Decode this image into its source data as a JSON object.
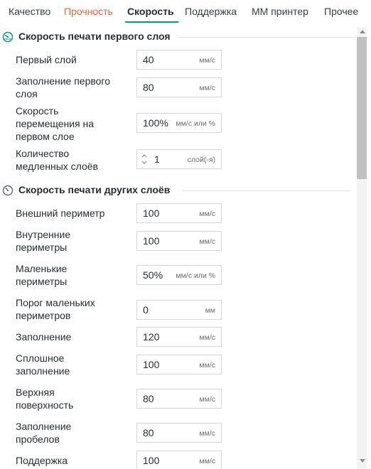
{
  "tabs": [
    {
      "label": "Качество"
    },
    {
      "label": "Прочность"
    },
    {
      "label": "Скорость"
    },
    {
      "label": "Поддержка"
    },
    {
      "label": "ММ принтер"
    },
    {
      "label": "Прочее"
    }
  ],
  "sections": [
    {
      "title": "Скорость печати первого слоя",
      "icon": "speedometer-icon",
      "rows": [
        {
          "label": "Первый слой",
          "value": "40",
          "unit": "мм/с"
        },
        {
          "label": "Заполнение первого слоя",
          "value": "80",
          "unit": "мм/с"
        },
        {
          "label": "Скорость перемещения на первом слое",
          "value": "100%",
          "unit": "мм/с или %"
        },
        {
          "label": "Количество медленных слоёв",
          "value": "1",
          "unit": "слой(-я)"
        }
      ]
    },
    {
      "title": "Скорость печати других слоёв",
      "icon": "speedometer-icon",
      "rows": [
        {
          "label": "Внешний периметр",
          "value": "100",
          "unit": "мм/с"
        },
        {
          "label": "Внутренние периметры",
          "value": "100",
          "unit": "мм/с"
        },
        {
          "label": "Маленькие периметры",
          "value": "50%",
          "unit": "мм/с или %"
        },
        {
          "label": "Порог маленьких периметров",
          "value": "0",
          "unit": "мм"
        },
        {
          "label": "Заполнение",
          "value": "120",
          "unit": "мм/с"
        },
        {
          "label": "Сплошное заполнение",
          "value": "100",
          "unit": "мм/с"
        },
        {
          "label": "Верхняя поверхность",
          "value": "80",
          "unit": "мм/с"
        },
        {
          "label": "Заполнение пробелов",
          "value": "80",
          "unit": "мм/с"
        },
        {
          "label": "Поддержка",
          "value": "100",
          "unit": "мм/с"
        }
      ]
    }
  ],
  "label_lines": {
    "s0r1": [
      "Заполнение первого",
      "слоя"
    ],
    "s0r2": [
      "Скорость",
      "перемещения на",
      "первом слое"
    ],
    "s0r3": [
      "Количество",
      "медленных слоёв"
    ],
    "s1r1": [
      "Внутренние",
      "периметры"
    ],
    "s1r2": [
      "Маленькие",
      "периметры"
    ],
    "s1r3": [
      "Порог маленьких",
      "периметров"
    ],
    "s1r5": [
      "Сплошное",
      "заполнение"
    ],
    "s1r6": [
      "Верхняя",
      "поверхность"
    ],
    "s1r7": [
      "Заполнение",
      "пробелов"
    ]
  },
  "colors": {
    "accent": "#009688",
    "warning_tab": "#e8643a",
    "text": "#262e30"
  }
}
